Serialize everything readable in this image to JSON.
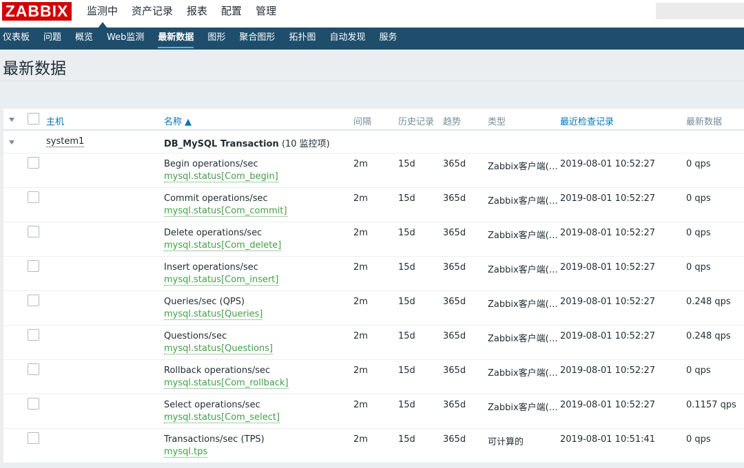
{
  "brand": {
    "logo_text": "ZABBIX",
    "logo_color": "#d40000"
  },
  "top_menu": [
    {
      "label": "监测中",
      "active": true
    },
    {
      "label": "资产记录"
    },
    {
      "label": "报表"
    },
    {
      "label": "配置"
    },
    {
      "label": "管理"
    }
  ],
  "sub_menu": [
    {
      "label": "仪表板"
    },
    {
      "label": "问题"
    },
    {
      "label": "概览"
    },
    {
      "label": "Web监测"
    },
    {
      "label": "最新数据",
      "active": true
    },
    {
      "label": "图形"
    },
    {
      "label": "聚合图形"
    },
    {
      "label": "拓扑图"
    },
    {
      "label": "自动发现"
    },
    {
      "label": "服务"
    }
  ],
  "page": {
    "title": "最新数据"
  },
  "table": {
    "headers": {
      "host": "主机",
      "name": "名称 ▲",
      "interval": "间隔",
      "history": "历史记录",
      "trends": "趋势",
      "type": "类型",
      "last_check": "最近检查记录",
      "last_value": "最新数据"
    },
    "group": {
      "host": "system1",
      "application": "DB_MySQL Transaction",
      "count_text": "(10 监控项)"
    },
    "rows": [
      {
        "name": "Begin operations/sec",
        "key": "mysql.status[Com_begin]",
        "interval": "2m",
        "history": "15d",
        "trends": "365d",
        "type": "Zabbix客户端(…",
        "last_check": "2019-08-01 10:52:27",
        "last_value": "0 qps"
      },
      {
        "name": "Commit operations/sec",
        "key": "mysql.status[Com_commit]",
        "interval": "2m",
        "history": "15d",
        "trends": "365d",
        "type": "Zabbix客户端(…",
        "last_check": "2019-08-01 10:52:27",
        "last_value": "0 qps"
      },
      {
        "name": "Delete operations/sec",
        "key": "mysql.status[Com_delete]",
        "interval": "2m",
        "history": "15d",
        "trends": "365d",
        "type": "Zabbix客户端(…",
        "last_check": "2019-08-01 10:52:27",
        "last_value": "0 qps"
      },
      {
        "name": "Insert operations/sec",
        "key": "mysql.status[Com_insert]",
        "interval": "2m",
        "history": "15d",
        "trends": "365d",
        "type": "Zabbix客户端(…",
        "last_check": "2019-08-01 10:52:27",
        "last_value": "0 qps"
      },
      {
        "name": "Queries/sec (QPS)",
        "key": "mysql.status[Queries]",
        "interval": "2m",
        "history": "15d",
        "trends": "365d",
        "type": "Zabbix客户端(…",
        "last_check": "2019-08-01 10:52:27",
        "last_value": "0.248 qps"
      },
      {
        "name": "Questions/sec",
        "key": "mysql.status[Questions]",
        "interval": "2m",
        "history": "15d",
        "trends": "365d",
        "type": "Zabbix客户端(…",
        "last_check": "2019-08-01 10:52:27",
        "last_value": "0.248 qps"
      },
      {
        "name": "Rollback operations/sec",
        "key": "mysql.status[Com_rollback]",
        "interval": "2m",
        "history": "15d",
        "trends": "365d",
        "type": "Zabbix客户端(…",
        "last_check": "2019-08-01 10:52:27",
        "last_value": "0 qps"
      },
      {
        "name": "Select operations/sec",
        "key": "mysql.status[Com_select]",
        "interval": "2m",
        "history": "15d",
        "trends": "365d",
        "type": "Zabbix客户端(…",
        "last_check": "2019-08-01 10:52:27",
        "last_value": "0.1157 qps"
      },
      {
        "name": "Transactions/sec (TPS)",
        "key": "mysql.tps",
        "interval": "2m",
        "history": "15d",
        "trends": "365d",
        "type": "可计算的",
        "last_check": "2019-08-01 10:51:41",
        "last_value": "0 qps"
      }
    ]
  }
}
